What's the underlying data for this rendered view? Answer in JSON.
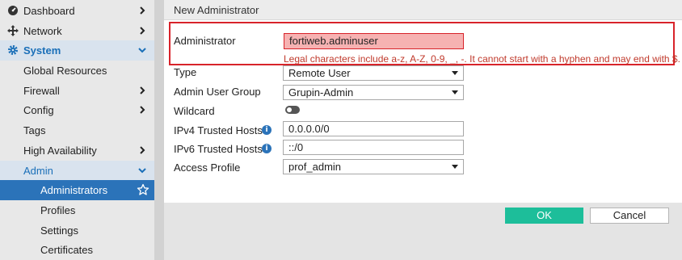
{
  "sidebar": {
    "items": [
      {
        "label": "Dashboard",
        "icon": "dashboard-icon",
        "chevron": "right"
      },
      {
        "label": "Network",
        "icon": "network-icon",
        "chevron": "right"
      },
      {
        "label": "System",
        "icon": "gear-icon",
        "chevron": "down"
      },
      {
        "label": "Global Resources",
        "chevron": "none"
      },
      {
        "label": "Firewall",
        "chevron": "right"
      },
      {
        "label": "Config",
        "chevron": "right"
      },
      {
        "label": "Tags",
        "chevron": "none"
      },
      {
        "label": "High Availability",
        "chevron": "right"
      },
      {
        "label": "Admin",
        "chevron": "down"
      },
      {
        "label": "Administrators",
        "icon": "star-icon"
      },
      {
        "label": "Profiles"
      },
      {
        "label": "Settings"
      },
      {
        "label": "Certificates"
      }
    ]
  },
  "panel": {
    "title": "New Administrator",
    "fields": {
      "administrator": {
        "label": "Administrator",
        "value": "fortiweb.adminuser",
        "error": "Legal characters include a-z, A-Z, 0-9, _, -. It cannot start with a hyphen and may end with $."
      },
      "type": {
        "label": "Type",
        "value": "Remote User"
      },
      "admin_user_group": {
        "label": "Admin User Group",
        "value": "Grupin-Admin"
      },
      "wildcard": {
        "label": "Wildcard",
        "enabled": false
      },
      "ipv4": {
        "label": "IPv4 Trusted Hosts",
        "value": "0.0.0.0/0"
      },
      "ipv6": {
        "label": "IPv6 Trusted Hosts",
        "value": "::/0"
      },
      "access_profile": {
        "label": "Access Profile",
        "value": "prof_admin"
      }
    }
  },
  "buttons": {
    "ok": "OK",
    "cancel": "Cancel"
  },
  "colors": {
    "accent": "#2b73b9",
    "ok": "#1dbe9a",
    "error": "#d8232a",
    "error_bg": "#f6b2b2"
  }
}
